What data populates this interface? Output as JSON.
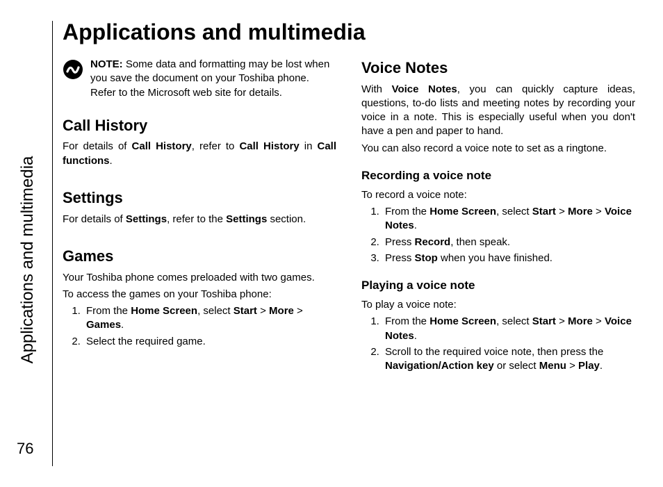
{
  "sidebar": {
    "label": "Applications and multimedia",
    "page_number": "76"
  },
  "title": "Applications and multimedia",
  "left_column": {
    "note": {
      "label": "NOTE:",
      "text": " Some data and formatting may be lost when you save the document on your Toshiba phone. Refer to the Microsoft web site for details."
    },
    "call_history": {
      "heading": "Call History",
      "pre1": "For details of ",
      "b1": "Call History",
      "mid1": ", refer to ",
      "b2": "Call History",
      "mid2": " in ",
      "b3": "Call functions",
      "post": "."
    },
    "settings": {
      "heading": "Settings",
      "pre1": "For details of ",
      "b1": "Settings",
      "mid1": ", refer to the ",
      "b2": "Settings",
      "post": " section."
    },
    "games": {
      "heading": "Games",
      "intro": "Your Toshiba phone comes preloaded with two games.",
      "lead": "To access the games on your Toshiba phone:",
      "step1": {
        "pre": "From the ",
        "b1": "Home Screen",
        "mid1": ", select ",
        "b2": "Start",
        "mid2": " > ",
        "b3": "More",
        "mid3": " > ",
        "b4": "Games",
        "post": "."
      },
      "step2": "Select the required game."
    }
  },
  "right_column": {
    "voice_notes": {
      "heading": "Voice Notes",
      "intro_pre": "With ",
      "intro_b": "Voice Notes",
      "intro_post": ", you can quickly capture ideas, questions, to-do lists and meeting notes by recording your voice in a note. This is especially useful when you don't have a pen and paper to hand.",
      "intro2": "You can also record a voice note to set as a ringtone."
    },
    "recording": {
      "heading": "Recording a voice note",
      "lead": "To record a voice note:",
      "step1": {
        "pre": "From the ",
        "b1": "Home Screen",
        "mid1": ", select ",
        "b2": "Start",
        "mid2": " > ",
        "b3": "More",
        "mid3": " > ",
        "b4": "Voice Notes",
        "post": "."
      },
      "step2": {
        "pre": "Press ",
        "b1": "Record",
        "post": ", then speak."
      },
      "step3": {
        "pre": "Press ",
        "b1": "Stop",
        "post": " when you have finished."
      }
    },
    "playing": {
      "heading": "Playing a voice note",
      "lead": "To play a voice note:",
      "step1": {
        "pre": "From the ",
        "b1": "Home Screen",
        "mid1": ", select ",
        "b2": "Start",
        "mid2": " > ",
        "b3": "More",
        "mid3": " > ",
        "b4": "Voice Notes",
        "post": "."
      },
      "step2": {
        "pre": "Scroll to the required voice note, then press the ",
        "b1": "Navigation/Action key",
        "mid1": " or select ",
        "b2": "Menu",
        "mid2": " > ",
        "b3": "Play",
        "post": "."
      }
    }
  }
}
